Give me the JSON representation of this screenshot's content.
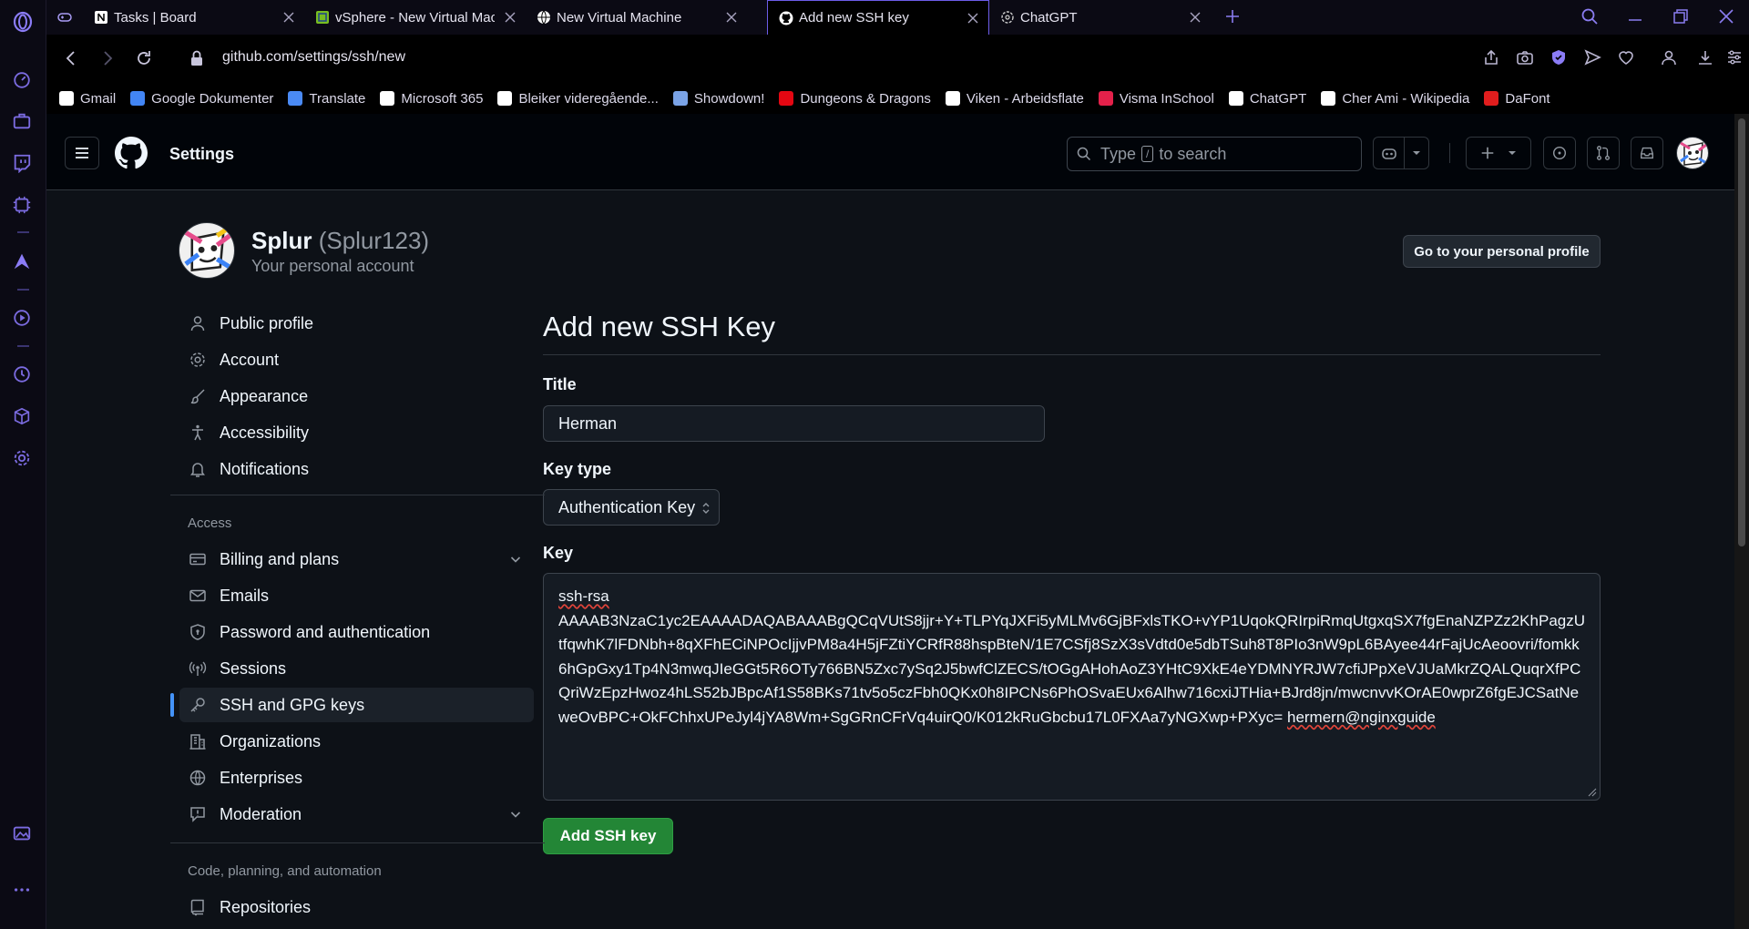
{
  "browser": {
    "tabs": [
      {
        "title": "Tasks | Board",
        "icon": "notion-icon",
        "active": false
      },
      {
        "title": "vSphere - New Virtual Mach",
        "icon": "vsphere-icon",
        "active": false
      },
      {
        "title": "New Virtual Machine",
        "icon": "globe-icon",
        "active": false
      },
      {
        "title": "Add new SSH key",
        "icon": "github-icon",
        "active": true
      },
      {
        "title": "ChatGPT",
        "icon": "chatgpt-icon",
        "active": false
      }
    ],
    "url": "github.com/settings/ssh/new",
    "bookmarks": [
      {
        "label": "Gmail",
        "color": "#ffffff"
      },
      {
        "label": "Google Dokumenter",
        "color": "#4285f4"
      },
      {
        "label": "Translate",
        "color": "#4a8af4"
      },
      {
        "label": "Microsoft 365",
        "color": "#ffffff"
      },
      {
        "label": "Bleiker videregående...",
        "color": "#ffffff"
      },
      {
        "label": "Showdown!",
        "color": "#7aa3e6"
      },
      {
        "label": "Dungeons & Dragons",
        "color": "#e40712"
      },
      {
        "label": "Viken - Arbeidsflate",
        "color": "#ffffff"
      },
      {
        "label": "Visma InSchool",
        "color": "#e4214a"
      },
      {
        "label": "ChatGPT",
        "color": "#ffffff"
      },
      {
        "label": "Cher Ami - Wikipedia",
        "color": "#ffffff"
      },
      {
        "label": "DaFont",
        "color": "#e11d1d"
      }
    ]
  },
  "header": {
    "title": "Settings",
    "search_prefix": "Type",
    "search_key": "/",
    "search_suffix": "to search"
  },
  "account": {
    "name": "Splur",
    "handle": "(Splur123)",
    "subtitle": "Your personal account",
    "profile_button": "Go to your personal profile"
  },
  "sidebar": {
    "top_items": [
      {
        "label": "Public profile",
        "icon": "person-icon"
      },
      {
        "label": "Account",
        "icon": "gear-icon"
      },
      {
        "label": "Appearance",
        "icon": "paintbrush-icon"
      },
      {
        "label": "Accessibility",
        "icon": "accessibility-icon"
      },
      {
        "label": "Notifications",
        "icon": "bell-icon"
      }
    ],
    "access_heading": "Access",
    "access_items": [
      {
        "label": "Billing and plans",
        "icon": "credit-card-icon",
        "expandable": true
      },
      {
        "label": "Emails",
        "icon": "mail-icon"
      },
      {
        "label": "Password and authentication",
        "icon": "shield-lock-icon"
      },
      {
        "label": "Sessions",
        "icon": "broadcast-icon"
      },
      {
        "label": "SSH and GPG keys",
        "icon": "key-icon",
        "active": true
      },
      {
        "label": "Organizations",
        "icon": "organization-icon"
      },
      {
        "label": "Enterprises",
        "icon": "globe-icon"
      },
      {
        "label": "Moderation",
        "icon": "report-icon",
        "expandable": true
      }
    ],
    "code_heading": "Code, planning, and automation",
    "code_items": [
      {
        "label": "Repositories",
        "icon": "repo-icon"
      }
    ]
  },
  "form": {
    "heading": "Add new SSH Key",
    "title_label": "Title",
    "title_value": "Herman",
    "keytype_label": "Key type",
    "keytype_value": "Authentication Key",
    "key_label": "Key",
    "key_first_line": "ssh-rsa",
    "key_body": "AAAAB3NzaC1yc2EAAAADAQABAAABgQCqVUtS8jjr+Y+TLPYqJXFi5yMLMv6GjBFxlsTKO+vYP1UqokQRIrpiRmqUtgxqSX7fgEnaNZPZz2KhPagzUtfqwhK7lFDNbh+8qXFhECiNPOcIjjvPM8a4H5jFZtiYCRfR88hspBteN/1E7CSfj8SzX3sVdtd0e5dbTSuh8T8PIo3nW9pL6BAyee44rFajUcAeoovri/fomkk6hGpGxy1Tp4N3mwqJIeGGt5R6OTy766BN5Zxc7ySq2J5bwfClZECS/tOGgAHohAoZ3YHtC9XkE4eYDMNYRJW7cfiJPpXeVJUaMkrZQALQuqrXfPCQriWzEpzHwoz4hLS52bJBpcAf1S58BKs71tv5o5czFbh0QKx0h8IPCNs6PhOSvaEUx6Alhw716cxiJTHia+BJrd8jn/mwcnvvKOrAE0wprZ6fgEJCSatNeweOvBPC+OkFChhxUPeJyl4jYA8Wm+SgGRnCFrVq4uirQ0/K012kRuGbcbu17L0FXAa7yNGXwp+PXyc=",
    "key_comment": "hermern@nginxguide",
    "submit_label": "Add SSH key"
  },
  "colors": {
    "accent_blue": "#4493f8",
    "button_green": "#238636",
    "opera_purple": "#7b6be0"
  }
}
